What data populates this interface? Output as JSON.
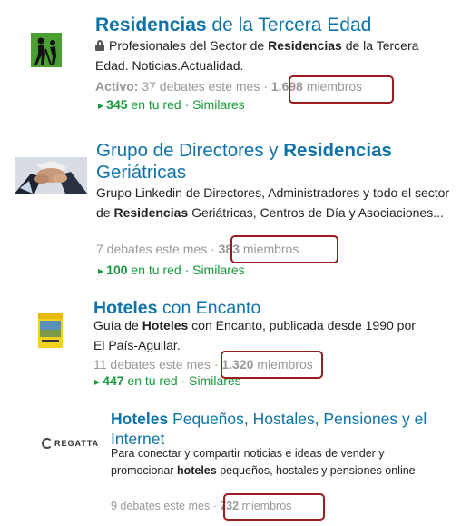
{
  "groups": [
    {
      "title_bold": "Residencias",
      "title_rest": " de la Tercera Edad",
      "desc_1": "Profesionales del Sector de ",
      "desc_bold": "Residencias",
      "desc_2": " de la Tercera Edad. Noticias.Actualidad.",
      "activity_label": "Activo:",
      "activity": " 37 debates este mes · ",
      "members": "1.698",
      "members_label": " miembros",
      "network_count": "345",
      "network_label": " en tu red · ",
      "similar": "Similares"
    },
    {
      "title_1": "Grupo de Directores y ",
      "title_bold": "Residencias",
      "title_2": "Geriátricas",
      "desc_1": "Grupo Linkedin de Directores, Administradores y todo el sector de ",
      "desc_bold": "Residencias",
      "desc_2": " Geriátricas, Centros de Día y Asociaciones...",
      "activity": "7 debates este mes · ",
      "members": "383",
      "members_label": " miembros",
      "network_count": "100",
      "network_label": " en tu red · ",
      "similar": "Similares"
    },
    {
      "title_bold": "Hoteles",
      "title_rest": " con Encanto",
      "desc_1": "Guía de ",
      "desc_bold": "Hoteles",
      "desc_2": " con Encanto, publicada desde 1990 por El País-Aguilar.",
      "activity": "11 debates este mes · ",
      "members": "1.320",
      "members_label": " miembros",
      "network_count": "447",
      "network_label": " en tu red · ",
      "similar": "Similares"
    },
    {
      "title_bold": "Hoteles",
      "title_rest": " Pequeños, Hostales, Pensiones y el Internet",
      "desc_1": "Para conectar y compartir noticias e ideas de vender y promocionar ",
      "desc_bold": "hoteles",
      "desc_2": " pequeños, hostales y pensiones online",
      "activity": "9 debates este mes · ",
      "members": "732",
      "members_label": " miembros",
      "logo_text": "REGATTA"
    }
  ],
  "colors": {
    "link": "#0e73a8",
    "network": "#179a3d",
    "muted": "#999999",
    "highlight": "#9b1c1c"
  }
}
